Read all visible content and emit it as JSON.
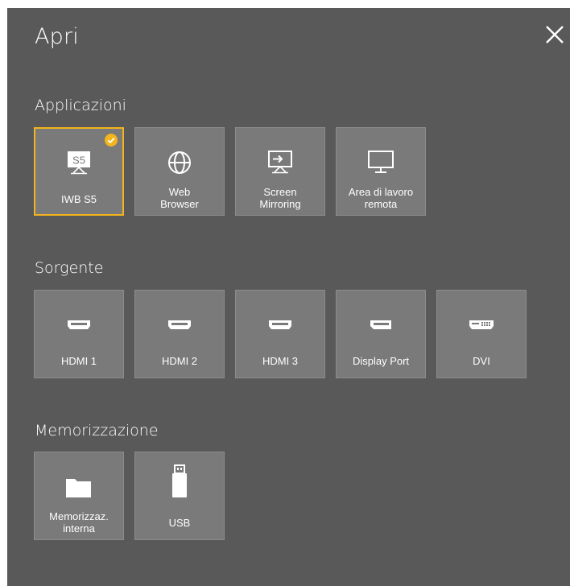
{
  "dialog": {
    "title": "Apri"
  },
  "sections": {
    "applications": {
      "label": "Applicazioni",
      "items": [
        {
          "label": "IWB S5",
          "icon": "iwb-s5-icon",
          "badge": "S5",
          "selected": true
        },
        {
          "label": "Web\nBrowser",
          "icon": "globe-icon"
        },
        {
          "label": "Screen\nMirroring",
          "icon": "screen-mirroring-icon"
        },
        {
          "label": "Area di lavoro\nremota",
          "icon": "monitor-icon"
        }
      ]
    },
    "source": {
      "label": "Sorgente",
      "items": [
        {
          "label": "HDMI 1",
          "icon": "hdmi-port-icon"
        },
        {
          "label": "HDMI 2",
          "icon": "hdmi-port-icon"
        },
        {
          "label": "HDMI 3",
          "icon": "hdmi-port-icon"
        },
        {
          "label": "Display Port",
          "icon": "displayport-icon"
        },
        {
          "label": "DVI",
          "icon": "dvi-port-icon"
        }
      ]
    },
    "storage": {
      "label": "Memorizzazione",
      "items": [
        {
          "label": "Memorizzaz.\ninterna",
          "icon": "folder-icon"
        },
        {
          "label": "USB",
          "icon": "usb-drive-icon"
        }
      ]
    }
  },
  "colors": {
    "panel_background": "#595959",
    "tile_background": "#7a7a7a",
    "selection_accent": "#f2b51c",
    "text": "#ffffff"
  }
}
